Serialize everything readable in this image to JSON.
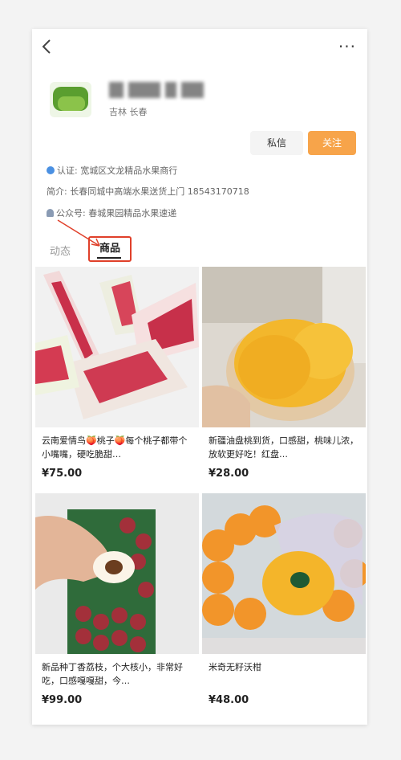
{
  "header": {
    "back_icon": "chevron-left-icon",
    "more_label": "···",
    "location": "吉林 长春"
  },
  "actions": {
    "message_label": "私信",
    "follow_label": "关注"
  },
  "profile": {
    "cert_key": "认证:",
    "cert_value": "宽城区文龙精品水果商行",
    "intro_key": "简介:",
    "intro_value": "长春同城中高端水果送货上门 18543170718",
    "public_key": "公众号:",
    "public_value": "春城果园精品水果速递"
  },
  "tabs": {
    "dynamic": "动态",
    "goods": "商品"
  },
  "products": [
    {
      "title": "云南爱情鸟🍑桃子🍑每个桃子都带个小嘴嘴，硬吃脆甜…",
      "price": "¥75.00"
    },
    {
      "title": "新疆油盘桃到货，口感甜，桃味儿浓，放软更好吃！红盘…",
      "price": "¥28.00"
    },
    {
      "title": "新品种丁香荔枝，个大核小，非常好吃，口感嘎嘎甜，今…",
      "price": "¥99.00"
    },
    {
      "title": "米奇无籽沃柑",
      "price": "¥48.00"
    }
  ],
  "colors": {
    "follow": "#f7a44a",
    "highlight": "#e0402a"
  }
}
